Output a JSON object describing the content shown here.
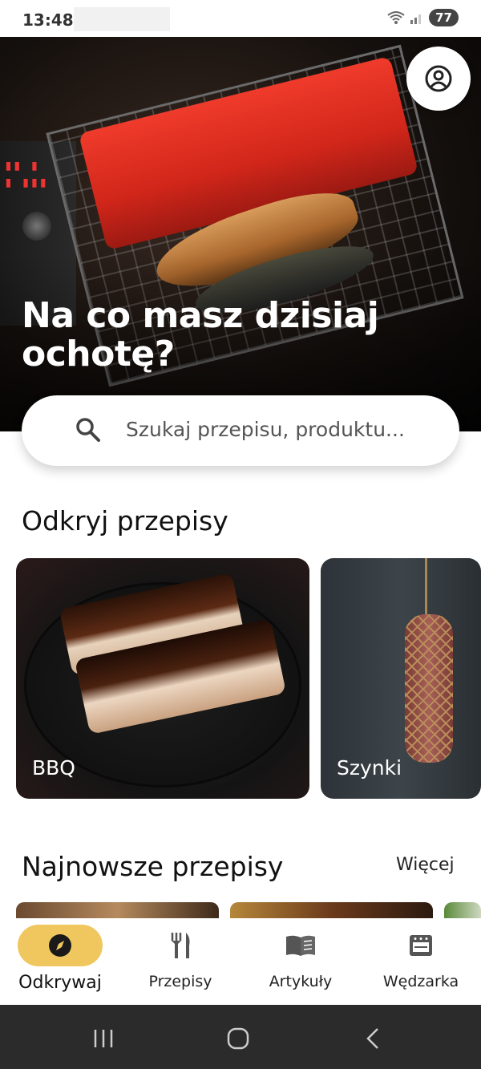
{
  "status_bar": {
    "time": "13:48",
    "battery": "77"
  },
  "hero": {
    "title": "Na co masz dzisiaj ochotę?"
  },
  "search": {
    "placeholder": "Szukaj przepisu, produktu..."
  },
  "discover": {
    "title": "Odkryj przepisy",
    "cards": [
      {
        "label": "BBQ"
      },
      {
        "label": "Szynki"
      }
    ]
  },
  "newest": {
    "title": "Najnowsze przepisy",
    "more_label": "Więcej"
  },
  "bottom_nav": {
    "items": [
      {
        "label": "Odkrywaj",
        "icon": "compass-icon",
        "active": true
      },
      {
        "label": "Przepisy",
        "icon": "fork-knife-icon",
        "active": false
      },
      {
        "label": "Artykuły",
        "icon": "book-icon",
        "active": false
      },
      {
        "label": "Wędzarka",
        "icon": "smoker-icon",
        "active": false
      }
    ]
  },
  "colors": {
    "accent": "#f0c75e",
    "system_nav": "#2b2b2b",
    "text": "#111111"
  }
}
